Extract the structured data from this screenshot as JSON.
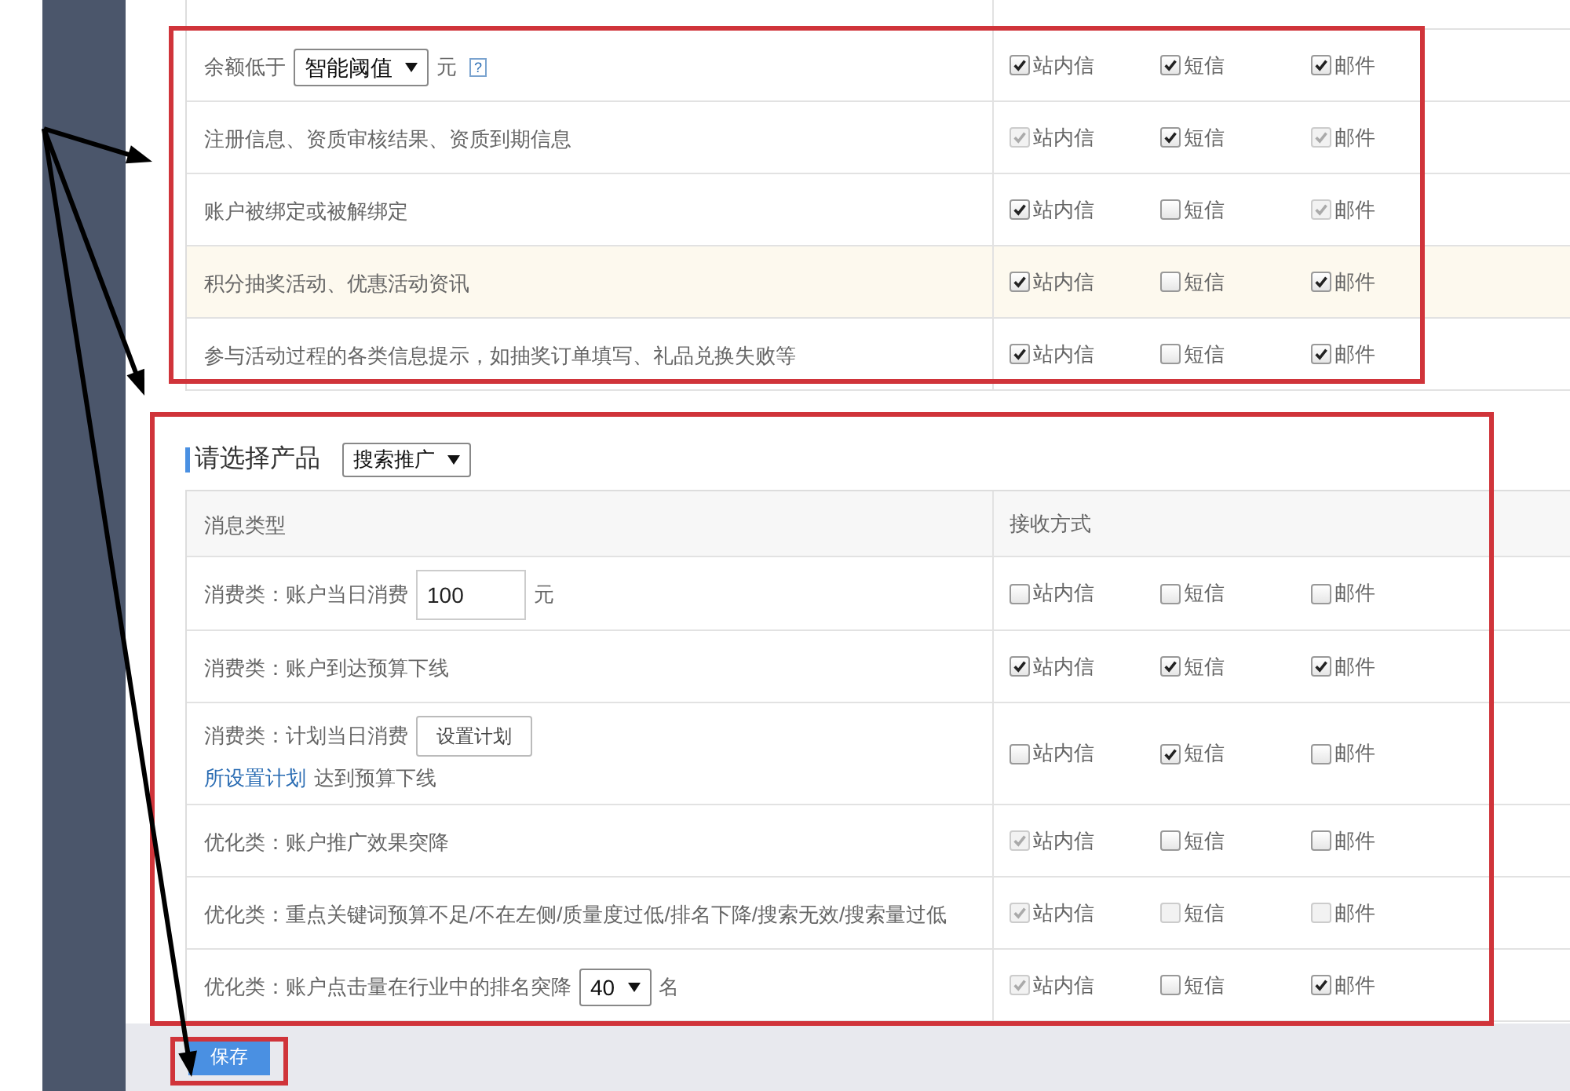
{
  "sections": [
    {
      "rows": [
        {
          "highlighted": false,
          "lines": [
            [
              {
                "kind": "text",
                "text": "余额低于"
              },
              {
                "kind": "select",
                "text": "智能阈值"
              },
              {
                "kind": "text",
                "text": "元"
              },
              {
                "kind": "help",
                "text": "?"
              }
            ]
          ],
          "channels": [
            {
              "label": "站内信",
              "checked": true,
              "disabled": false
            },
            {
              "label": "短信",
              "checked": true,
              "disabled": false
            },
            {
              "label": "邮件",
              "checked": true,
              "disabled": false
            }
          ]
        },
        {
          "highlighted": false,
          "lines": [
            [
              {
                "kind": "text",
                "text": "注册信息、资质审核结果、资质到期信息"
              }
            ]
          ],
          "channels": [
            {
              "label": "站内信",
              "checked": true,
              "disabled": true
            },
            {
              "label": "短信",
              "checked": true,
              "disabled": false
            },
            {
              "label": "邮件",
              "checked": true,
              "disabled": true
            }
          ]
        },
        {
          "highlighted": false,
          "lines": [
            [
              {
                "kind": "text",
                "text": "账户被绑定或被解绑定"
              }
            ]
          ],
          "channels": [
            {
              "label": "站内信",
              "checked": true,
              "disabled": false
            },
            {
              "label": "短信",
              "checked": false,
              "disabled": false
            },
            {
              "label": "邮件",
              "checked": true,
              "disabled": true
            }
          ]
        },
        {
          "highlighted": true,
          "lines": [
            [
              {
                "kind": "text",
                "text": "积分抽奖活动、优惠活动资讯"
              }
            ]
          ],
          "channels": [
            {
              "label": "站内信",
              "checked": true,
              "disabled": false
            },
            {
              "label": "短信",
              "checked": false,
              "disabled": false
            },
            {
              "label": "邮件",
              "checked": true,
              "disabled": false
            }
          ]
        },
        {
          "highlighted": false,
          "lines": [
            [
              {
                "kind": "text",
                "text": "参与活动过程的各类信息提示，如抽奖订单填写、礼品兑换失败等"
              }
            ]
          ],
          "channels": [
            {
              "label": "站内信",
              "checked": true,
              "disabled": false
            },
            {
              "label": "短信",
              "checked": false,
              "disabled": false
            },
            {
              "label": "邮件",
              "checked": true,
              "disabled": false
            }
          ]
        }
      ]
    },
    {
      "title": "请选择产品",
      "product_select": "搜索推广",
      "columns": [
        "消息类型",
        "接收方式"
      ],
      "rows": [
        {
          "highlighted": false,
          "lines": [
            [
              {
                "kind": "text",
                "text": "消费类：账户当日消费"
              },
              {
                "kind": "input",
                "text": "100"
              },
              {
                "kind": "text",
                "text": "元"
              }
            ]
          ],
          "channels": [
            {
              "label": "站内信",
              "checked": false,
              "disabled": false
            },
            {
              "label": "短信",
              "checked": false,
              "disabled": false
            },
            {
              "label": "邮件",
              "checked": false,
              "disabled": false
            }
          ]
        },
        {
          "highlighted": false,
          "lines": [
            [
              {
                "kind": "text",
                "text": "消费类：账户到达预算下线"
              }
            ]
          ],
          "channels": [
            {
              "label": "站内信",
              "checked": true,
              "disabled": false
            },
            {
              "label": "短信",
              "checked": true,
              "disabled": false
            },
            {
              "label": "邮件",
              "checked": true,
              "disabled": false
            }
          ]
        },
        {
          "highlighted": false,
          "lines": [
            [
              {
                "kind": "text",
                "text": "消费类：计划当日消费"
              },
              {
                "kind": "button",
                "text": "设置计划"
              }
            ],
            [
              {
                "kind": "link",
                "text": "所设置计划"
              },
              {
                "kind": "text",
                "text": "达到预算下线"
              }
            ]
          ],
          "channels": [
            {
              "label": "站内信",
              "checked": false,
              "disabled": false
            },
            {
              "label": "短信",
              "checked": true,
              "disabled": false
            },
            {
              "label": "邮件",
              "checked": false,
              "disabled": false
            }
          ]
        },
        {
          "highlighted": false,
          "lines": [
            [
              {
                "kind": "text",
                "text": "优化类：账户推广效果突降"
              }
            ]
          ],
          "channels": [
            {
              "label": "站内信",
              "checked": true,
              "disabled": true
            },
            {
              "label": "短信",
              "checked": false,
              "disabled": false
            },
            {
              "label": "邮件",
              "checked": false,
              "disabled": false
            }
          ]
        },
        {
          "highlighted": false,
          "lines": [
            [
              {
                "kind": "text",
                "text": "优化类：重点关键词预算不足/不在左侧/质量度过低/排名下降/搜索无效/搜索量过低"
              }
            ]
          ],
          "channels": [
            {
              "label": "站内信",
              "checked": true,
              "disabled": true
            },
            {
              "label": "短信",
              "checked": false,
              "disabled": true
            },
            {
              "label": "邮件",
              "checked": false,
              "disabled": true
            }
          ]
        },
        {
          "highlighted": false,
          "lines": [
            [
              {
                "kind": "text",
                "text": "优化类：账户点击量在行业中的排名突降"
              },
              {
                "kind": "select",
                "text": "40"
              },
              {
                "kind": "text",
                "text": "名"
              }
            ]
          ],
          "channels": [
            {
              "label": "站内信",
              "checked": true,
              "disabled": true
            },
            {
              "label": "短信",
              "checked": false,
              "disabled": false
            },
            {
              "label": "邮件",
              "checked": true,
              "disabled": false
            }
          ]
        }
      ]
    }
  ],
  "save_button": "保存",
  "annotations": [
    {
      "kind": "box"
    },
    {
      "kind": "box"
    },
    {
      "kind": "box"
    },
    {
      "kind": "arrow"
    },
    {
      "kind": "arrow"
    },
    {
      "kind": "arrow"
    }
  ]
}
